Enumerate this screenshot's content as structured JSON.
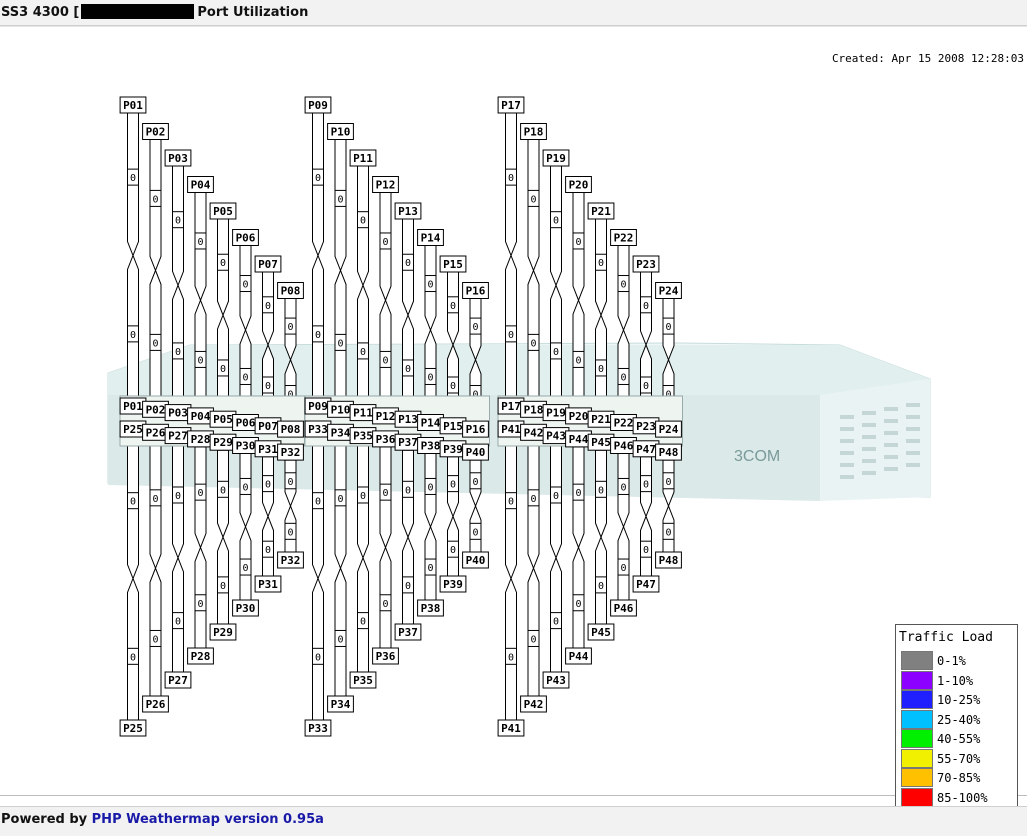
{
  "header": {
    "title_prefix": "SS3 4300 [",
    "title_suffix": "Port Utilization"
  },
  "created": "Created: Apr 15 2008 12:28:03",
  "footer": {
    "powered_by": "Powered by",
    "link_text": "PHP Weathermap version 0.95a"
  },
  "device": {
    "brand": "3COM"
  },
  "link_value": "0",
  "legend": {
    "title": "Traffic Load",
    "items": [
      {
        "label": "0-1%",
        "color": "#808080"
      },
      {
        "label": "1-10%",
        "color": "#8c00ff"
      },
      {
        "label": "10-25%",
        "color": "#2020ff"
      },
      {
        "label": "25-40%",
        "color": "#00c0ff"
      },
      {
        "label": "40-55%",
        "color": "#00f000"
      },
      {
        "label": "55-70%",
        "color": "#f0f000"
      },
      {
        "label": "70-85%",
        "color": "#ffc000"
      },
      {
        "label": "85-100%",
        "color": "#ff0000"
      }
    ]
  },
  "ports": [
    "P01",
    "P02",
    "P03",
    "P04",
    "P05",
    "P06",
    "P07",
    "P08",
    "P09",
    "P10",
    "P11",
    "P12",
    "P13",
    "P14",
    "P15",
    "P16",
    "P17",
    "P18",
    "P19",
    "P20",
    "P21",
    "P22",
    "P23",
    "P24",
    "P25",
    "P26",
    "P27",
    "P28",
    "P29",
    "P30",
    "P31",
    "P32",
    "P33",
    "P34",
    "P35",
    "P36",
    "P37",
    "P38",
    "P39",
    "P40",
    "P41",
    "P42",
    "P43",
    "P44",
    "P45",
    "P46",
    "P47",
    "P48"
  ]
}
